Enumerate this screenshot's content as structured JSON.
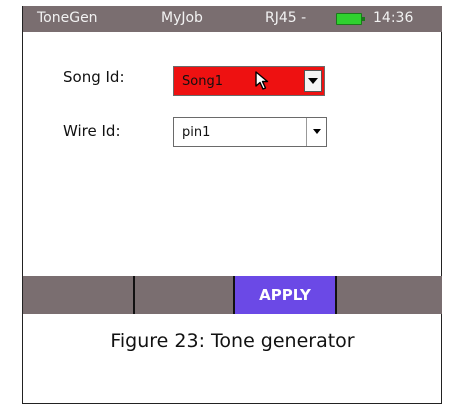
{
  "statusbar": {
    "app": "ToneGen",
    "job": "MyJob",
    "port": "RJ45 -",
    "time": "14:36",
    "battery_icon": "battery-full-icon",
    "battery_color": "#2fd12f"
  },
  "form": {
    "song_label": "Song Id:",
    "song_value": "Song1",
    "wire_label": "Wire Id:",
    "wire_value": "pin1",
    "highlight_color": "#ee1111"
  },
  "softkeys": [
    "",
    "",
    "APPLY",
    ""
  ],
  "softkey_accent": "#6b49e6",
  "caption": "Figure 23: Tone generator"
}
